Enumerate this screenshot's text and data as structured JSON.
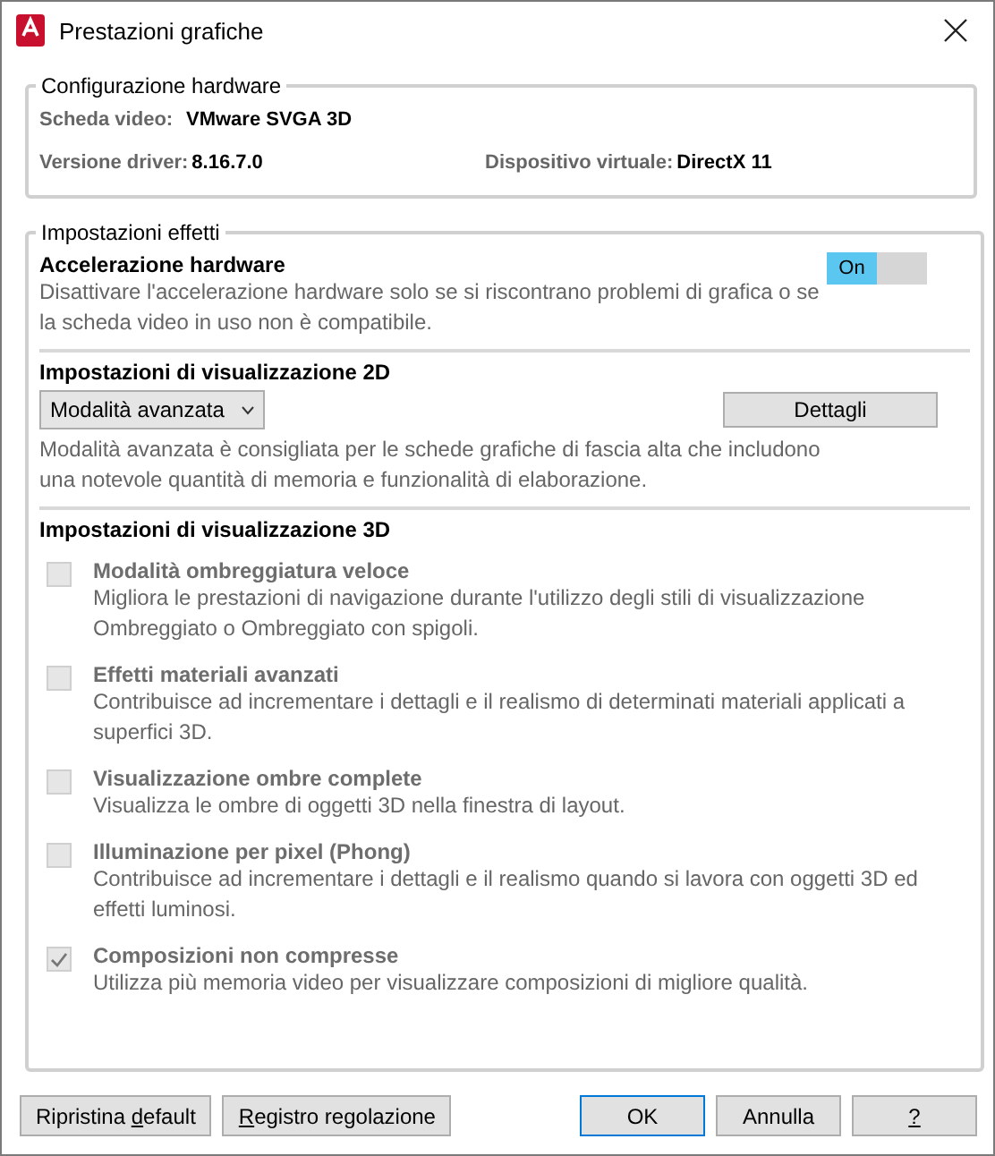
{
  "window": {
    "title": "Prestazioni grafiche"
  },
  "hardware": {
    "legend": "Configurazione hardware",
    "video_card": {
      "label": "Scheda video:",
      "value": "VMware SVGA 3D"
    },
    "driver": {
      "label": "Versione driver:",
      "value": "8.16.7.0"
    },
    "device": {
      "label": "Dispositivo virtuale:",
      "value": "DirectX 11"
    }
  },
  "effects": {
    "legend": "Impostazioni effetti",
    "acceleration": {
      "title": "Accelerazione hardware",
      "description": "Disattivare l'accelerazione hardware solo se si riscontrano problemi di grafica o se la scheda video in uso non è compatibile.",
      "toggle": {
        "label": "On",
        "on": true
      }
    },
    "display_2d": {
      "title": "Impostazioni di visualizzazione 2D",
      "dropdown": "Modalità avanzata",
      "details_button": "Dettagli",
      "description": "Modalità avanzata è consigliata per le schede grafiche di fascia alta che includono una notevole quantità di memoria e funzionalità di elaborazione."
    },
    "display_3d": {
      "title": "Impostazioni di visualizzazione 3D",
      "options": [
        {
          "title": "Modalità ombreggiatura veloce",
          "description": "Migliora le prestazioni di navigazione durante l'utilizzo degli stili di visualizzazione Ombreggiato o Ombreggiato con spigoli.",
          "checked": false,
          "disabled": true
        },
        {
          "title": "Effetti materiali avanzati",
          "description": "Contribuisce ad incrementare i dettagli e il realismo di determinati materiali applicati a superfici 3D.",
          "checked": false,
          "disabled": true
        },
        {
          "title": "Visualizzazione ombre complete",
          "description": "Visualizza le ombre di oggetti 3D nella finestra di layout.",
          "checked": false,
          "disabled": true
        },
        {
          "title": "Illuminazione per pixel (Phong)",
          "description": "Contribuisce ad incrementare i dettagli e il realismo quando si lavora con oggetti 3D ed effetti luminosi.",
          "checked": false,
          "disabled": true
        },
        {
          "title": "Composizioni non compresse",
          "description": "Utilizza più memoria video per visualizzare composizioni di migliore qualità.",
          "checked": true,
          "disabled": true
        }
      ]
    }
  },
  "buttons_left": [
    {
      "before": "Ripristina ",
      "access_key": "d",
      "after": "efault",
      "default": false
    },
    {
      "access_key": "R",
      "after": "egistro regolazione",
      "default": false
    }
  ],
  "buttons_right": [
    {
      "before": "OK",
      "default": true
    },
    {
      "before": "Annulla",
      "default": false
    },
    {
      "access_key": "?",
      "default": false
    }
  ]
}
